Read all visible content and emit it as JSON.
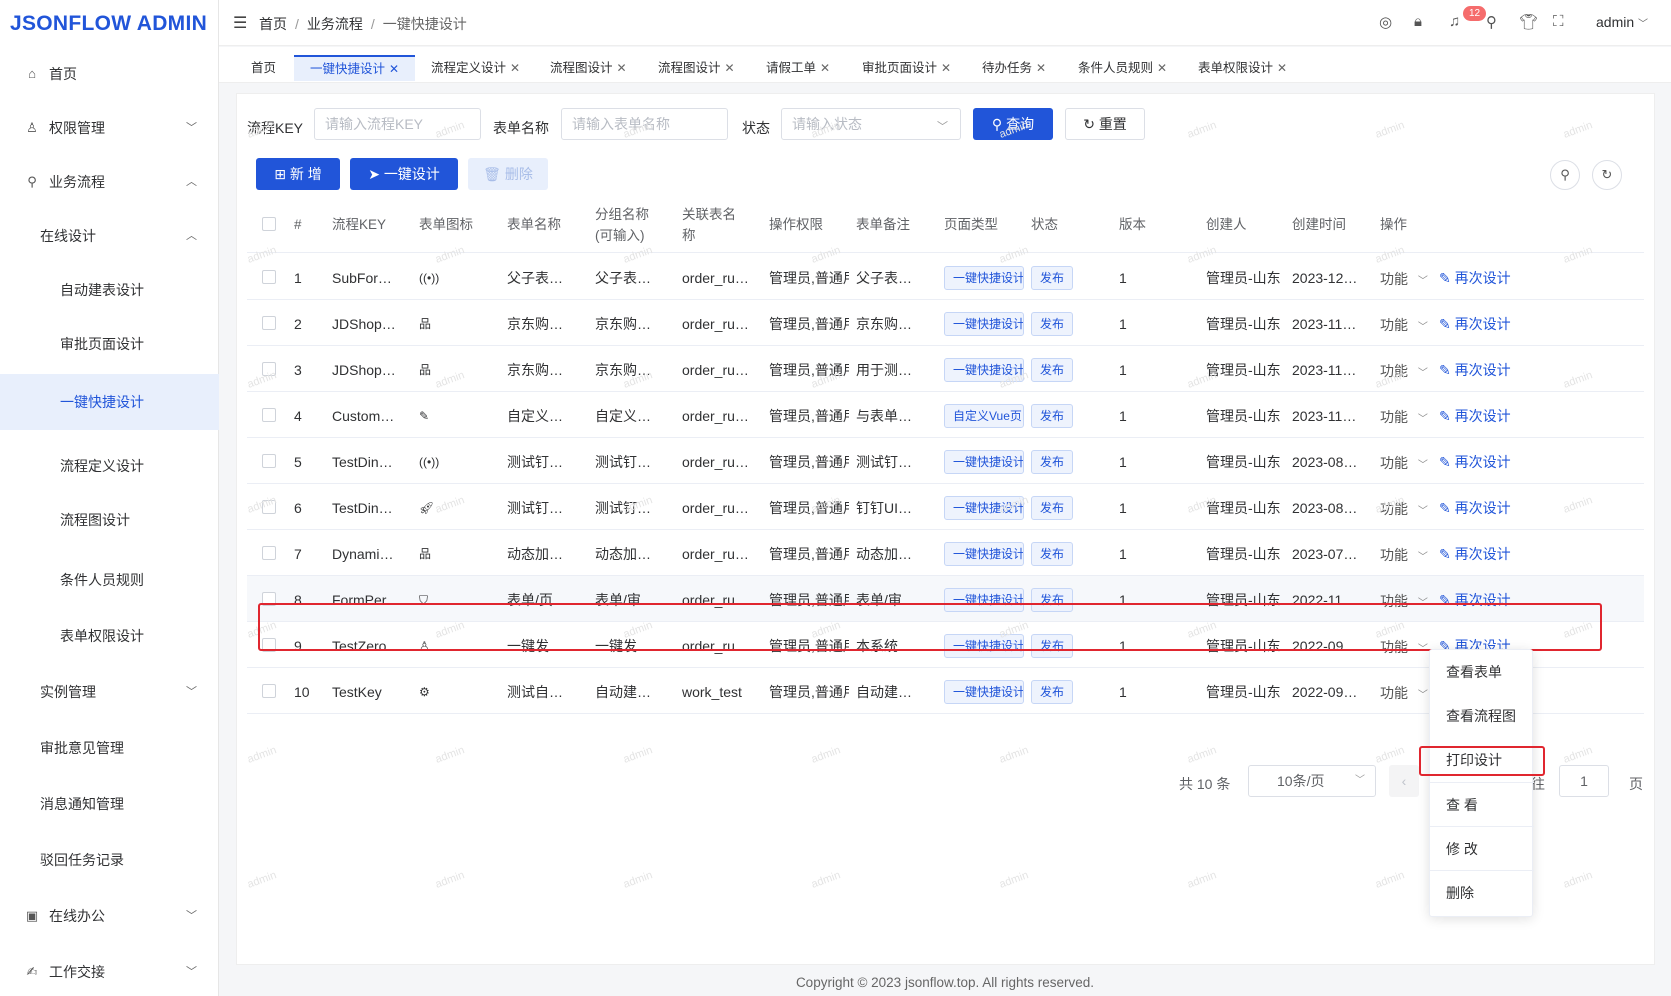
{
  "app": {
    "title": "JSONFLOW ADMIN"
  },
  "header": {
    "breadcrumb": [
      "首页",
      "业务流程",
      "一键快捷设计"
    ],
    "separator": "/",
    "notification_count": "12",
    "user": "admin"
  },
  "sidebar": {
    "items": [
      {
        "label": "首页",
        "icon": "home-icon"
      },
      {
        "label": "权限管理",
        "icon": "user-icon"
      },
      {
        "label": "业务流程",
        "icon": "flow-icon"
      },
      {
        "label": "在线设计"
      },
      {
        "label": "自动建表设计"
      },
      {
        "label": "审批页面设计"
      },
      {
        "label": "一键快捷设计"
      },
      {
        "label": "流程定义设计"
      },
      {
        "label": "流程图设计"
      },
      {
        "label": "条件人员规则"
      },
      {
        "label": "表单权限设计"
      },
      {
        "label": "实例管理"
      },
      {
        "label": "审批意见管理"
      },
      {
        "label": "消息通知管理"
      },
      {
        "label": "驳回任务记录"
      },
      {
        "label": "在线办公",
        "icon": "office-icon"
      },
      {
        "label": "工作交接",
        "icon": "handover-icon"
      }
    ]
  },
  "tabs": [
    "首页",
    "一键快捷设计",
    "流程定义设计",
    "流程图设计",
    "流程图设计",
    "请假工单",
    "审批页面设计",
    "待办任务",
    "条件人员规则",
    "表单权限设计"
  ],
  "filters": {
    "key_label": "流程KEY",
    "key_placeholder": "请输入流程KEY",
    "form_label": "表单名称",
    "form_placeholder": "请输入表单名称",
    "status_label": "状态",
    "status_placeholder": "请输入状态",
    "search_btn": "查询",
    "reset_btn": "重置"
  },
  "toolbar": {
    "add": "新 增",
    "quick": "一键设计",
    "delete": "删除"
  },
  "table": {
    "columns": [
      "#",
      "流程KEY",
      "表单图标",
      "表单名称",
      "分组名称",
      "(可输入)",
      "关联表名",
      "称",
      "操作权限",
      "表单备注",
      "页面类型",
      "状态",
      "版本",
      "创建人",
      "创建时间",
      "操作"
    ],
    "func_label": "功能",
    "redesign_label": "再次设计",
    "rows": [
      {
        "no": "1",
        "key": "SubFor…",
        "icon": "broadcast-icon",
        "form": "父子表…",
        "group": "父子表…",
        "table": "order_ru…",
        "perm": "管理员,普通用",
        "remark": "父子表…",
        "page": "一键快捷设计",
        "status": "发布",
        "ver": "1",
        "creator": "管理员-山东",
        "time": "2023-12…"
      },
      {
        "no": "2",
        "key": "JDShop…",
        "icon": "org-icon",
        "form": "京东购…",
        "group": "京东购…",
        "table": "order_ru…",
        "perm": "管理员,普通用",
        "remark": "京东购…",
        "page": "一键快捷设计",
        "status": "发布",
        "ver": "1",
        "creator": "管理员-山东",
        "time": "2023-11…"
      },
      {
        "no": "3",
        "key": "JDShop…",
        "icon": "org-icon",
        "form": "京东购…",
        "group": "京东购…",
        "table": "order_ru…",
        "perm": "管理员,普通用",
        "remark": "用于测…",
        "page": "一键快捷设计",
        "status": "发布",
        "ver": "1",
        "creator": "管理员-山东",
        "time": "2023-11…"
      },
      {
        "no": "4",
        "key": "Custom…",
        "icon": "edit-doc-icon",
        "form": "自定义…",
        "group": "自定义…",
        "table": "order_ru…",
        "perm": "管理员,普通用",
        "remark": "与表单…",
        "page": "自定义Vue页",
        "status": "发布",
        "ver": "1",
        "creator": "管理员-山东",
        "time": "2023-11…"
      },
      {
        "no": "5",
        "key": "TestDin…",
        "icon": "broadcast-icon",
        "form": "测试钉…",
        "group": "测试钉…",
        "table": "order_ru…",
        "perm": "管理员,普通用",
        "remark": "测试钉…",
        "page": "一键快捷设计",
        "status": "发布",
        "ver": "1",
        "creator": "管理员-山东",
        "time": "2023-08…"
      },
      {
        "no": "6",
        "key": "TestDin…",
        "icon": "rocket-icon",
        "form": "测试钉…",
        "group": "测试钉…",
        "table": "order_ru…",
        "perm": "管理员,普通用",
        "remark": "钉钉UI…",
        "page": "一键快捷设计",
        "status": "发布",
        "ver": "1",
        "creator": "管理员-山东",
        "time": "2023-08…"
      },
      {
        "no": "7",
        "key": "Dynami…",
        "icon": "org-icon",
        "form": "动态加…",
        "group": "动态加…",
        "table": "order_ru…",
        "perm": "管理员,普通用",
        "remark": "动态加…",
        "page": "一键快捷设计",
        "status": "发布",
        "ver": "1",
        "creator": "管理员-山东",
        "time": "2023-07…"
      },
      {
        "no": "8",
        "key": "FormPer…",
        "icon": "shield-icon",
        "form": "表单/页…",
        "group": "表单/审…",
        "table": "order_ru…",
        "perm": "管理员,普通用",
        "remark": "表单/审…",
        "page": "一键快捷设计",
        "status": "发布",
        "ver": "1",
        "creator": "管理员-山东",
        "time": "2022-11…"
      },
      {
        "no": "9",
        "key": "TestZero…",
        "icon": "person-icon",
        "form": "一键发…",
        "group": "一键发…",
        "table": "order_ru…",
        "perm": "管理员,普通用",
        "remark": "本系统…",
        "page": "一键快捷设计",
        "status": "发布",
        "ver": "1",
        "creator": "管理员-山东",
        "time": "2022-09…"
      },
      {
        "no": "10",
        "key": "TestKey",
        "icon": "gear-icon",
        "form": "测试自…",
        "group": "自动建…",
        "table": "work_test",
        "perm": "管理员,普通用",
        "remark": "自动建…",
        "page": "一键快捷设计",
        "status": "发布",
        "ver": "1",
        "creator": "管理员-山东",
        "time": "2022-09…"
      }
    ]
  },
  "pagination": {
    "total": "共 10 条",
    "page_size": "10条/页",
    "goto": "前往",
    "page": "1",
    "page_suffix": "页"
  },
  "dropdown": [
    "查看表单",
    "查看流程图",
    "打印设计",
    "查 看",
    "修 改",
    "删除"
  ],
  "watermark": "admin",
  "footer": "Copyright © 2023 jsonflow.top. All rights reserved.",
  "colors": {
    "primary": "#2155d9",
    "highlight": "#e0262f",
    "badge": "#f56c6c"
  }
}
